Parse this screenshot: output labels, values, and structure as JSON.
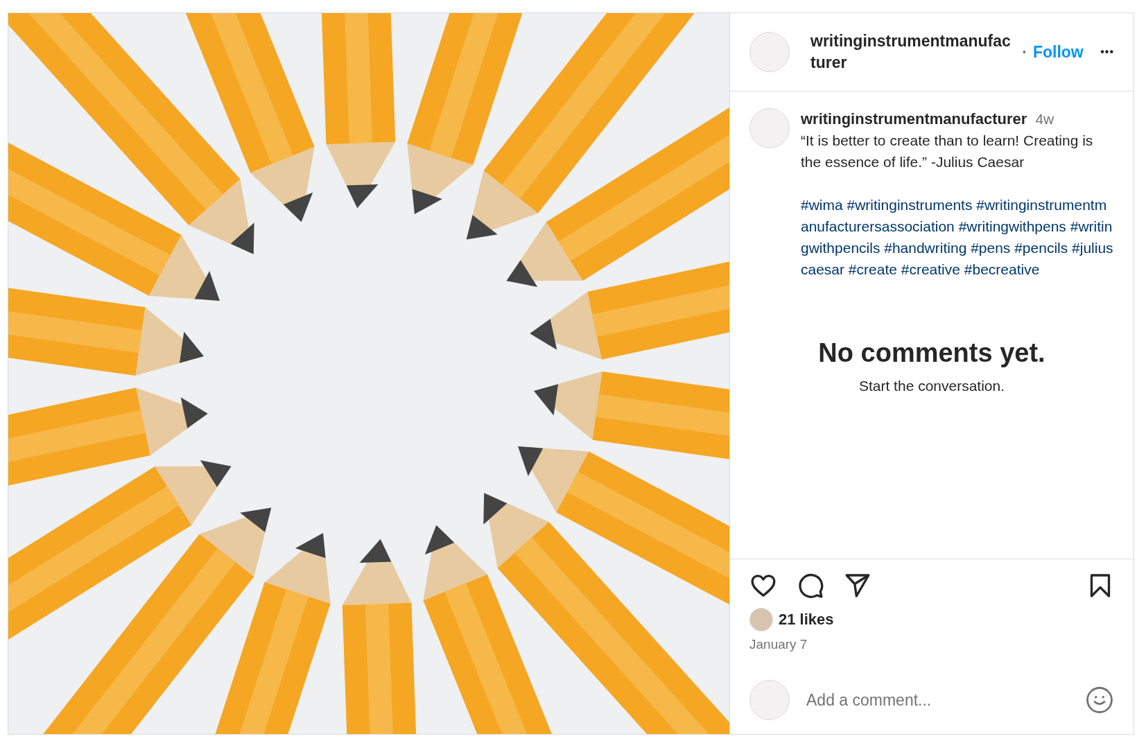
{
  "header": {
    "username": "writinginstrumentmanufacturer",
    "separator": "•",
    "follow": "Follow",
    "more": "•••"
  },
  "caption": {
    "username": "writinginstrumentmanufacturer",
    "time": "4w",
    "text": "“It is better to create than to learn! Creating is the essence of life.” -Julius Caesar",
    "hashtags": "#wima #writinginstruments #writinginstrumentmanufacturersassociation #writingwithpens #writingwithpencils #handwriting #pens #pencils #juliuscaesar #create #creative #becreative"
  },
  "comments": {
    "title": "No comments yet.",
    "subtitle": "Start the conversation."
  },
  "actions": {
    "liked": false,
    "saved": false
  },
  "likes": "21 likes",
  "date": "January 7",
  "comment_box": {
    "placeholder": "Add a comment..."
  }
}
